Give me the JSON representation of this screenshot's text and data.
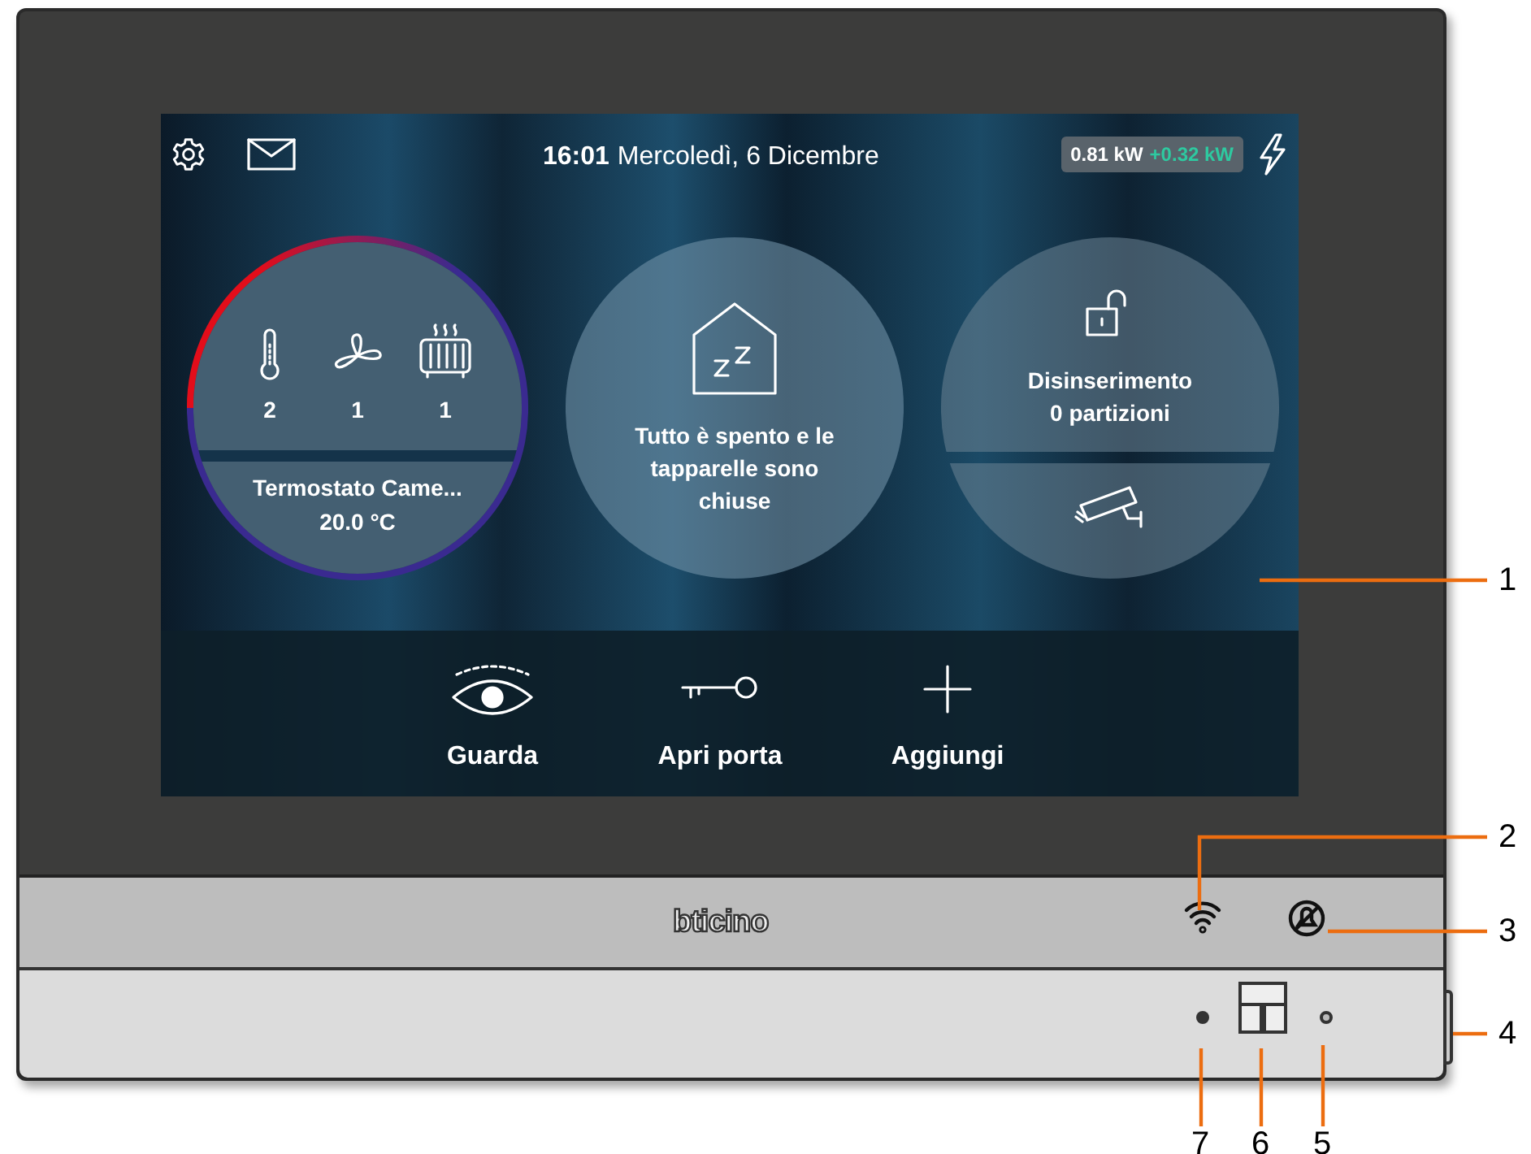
{
  "header": {
    "time": "16:01",
    "date": "Mercoledì, 6 Dicembre",
    "power": "0.81 kW",
    "power_delta": "+0.32 kW"
  },
  "tiles": [
    {
      "kind": "thermostat",
      "counts": [
        "2",
        "1",
        "1"
      ],
      "name": "Termostato Came...",
      "temperature": "20.0 °C"
    },
    {
      "kind": "scenario",
      "text": "Tutto è spento e le tapparelle sono chiuse"
    },
    {
      "kind": "alarm",
      "status": "Disinserimento 0 partizioni"
    }
  ],
  "actions": [
    {
      "kind": "watch",
      "label": "Guarda"
    },
    {
      "kind": "door",
      "label": "Apri porta"
    },
    {
      "kind": "add",
      "label": "Aggiungi"
    }
  ],
  "brand": "bticino",
  "callouts": [
    "1",
    "2",
    "3",
    "4",
    "7",
    "6",
    "5"
  ]
}
